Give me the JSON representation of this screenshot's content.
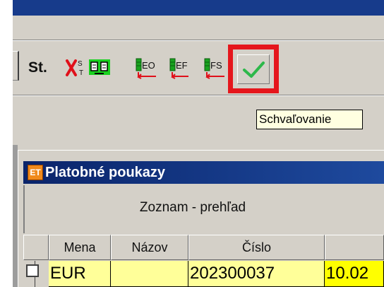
{
  "toolbar": {
    "st_label": "St.",
    "xst_symbol": "X",
    "xst_sup": "S",
    "xst_sub": "T",
    "eo_label": "EO",
    "ef_label": "EF",
    "fs_label": "FS"
  },
  "tooltip": {
    "text": "Schvaľovanie"
  },
  "window": {
    "icon_text": "ET",
    "title": "Platobné poukazy",
    "subheader": "Zoznam - prehľad"
  },
  "grid": {
    "columns": [
      "Mena",
      "Názov",
      "Číslo"
    ],
    "row": {
      "mena": "EUR",
      "nazov": "",
      "cislo": "202300037",
      "date_partial": "10.02"
    }
  },
  "colors": {
    "titlebar": "#173b8b",
    "highlight": "#e5161c",
    "check_green": "#2db84a",
    "tooltip_bg": "#ffffe1",
    "cell_yellow": "#ffff99"
  }
}
